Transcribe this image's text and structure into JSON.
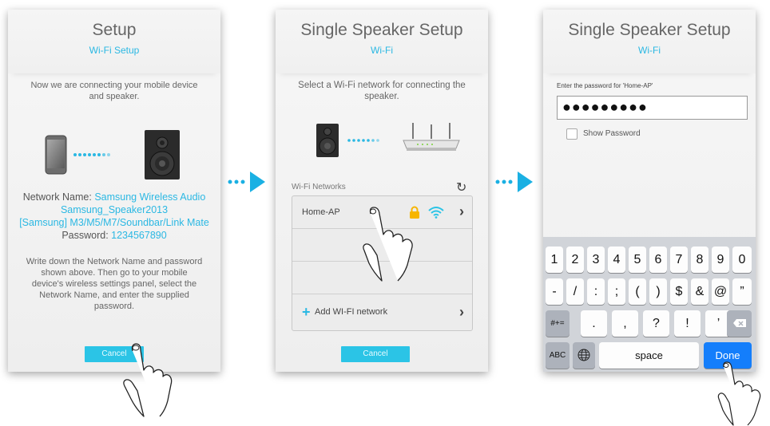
{
  "screen1": {
    "title": "Setup",
    "subtitle": "Wi-Fi Setup",
    "intro": "Now we are connecting your mobile device and speaker.",
    "network_name_label": "Network Name:",
    "network_name_value_1": "Samsung Wireless Audio",
    "network_name_value_2": "Samsung_Speaker2013",
    "network_name_value_3": "[Samsung] M3/M5/M7/Soundbar/Link Mate",
    "password_label": "Password:",
    "password_value": "1234567890",
    "instructions": "Write down the Network Name and password shown above. Then go to your mobile device's wireless settings panel, select the Network Name, and enter the supplied password.",
    "cancel_label": "Cancel"
  },
  "screen2": {
    "title": "Single Speaker Setup",
    "subtitle": "Wi-Fi",
    "intro": "Select a Wi-Fi network for connecting the speaker.",
    "networks_label": "Wi-Fi Networks",
    "networks": [
      {
        "name": "Home-AP"
      },
      {
        "name": ""
      },
      {
        "name": ""
      }
    ],
    "add_network_label": "Add WI-FI network",
    "cancel_label": "Cancel"
  },
  "screen3": {
    "title": "Single Speaker Setup",
    "subtitle": "Wi-Fi",
    "password_prompt": "Enter the password for 'Home-AP'",
    "password_masked": "●●●●●●●●●",
    "show_password_label": "Show Password",
    "keyboard": {
      "row1": [
        "1",
        "2",
        "3",
        "4",
        "5",
        "6",
        "7",
        "8",
        "9",
        "0"
      ],
      "row2": [
        "-",
        "/",
        ":",
        ";",
        "(",
        ")",
        "$",
        "&",
        "@",
        "”"
      ],
      "row3_mode": "#+=",
      "row3": [
        ".",
        ",",
        "?",
        "!",
        "’"
      ],
      "abc_label": "ABC",
      "space_label": "space",
      "done_label": "Done"
    }
  },
  "colors": {
    "accent": "#2bb8e3",
    "button": "#2bc4e6",
    "done_key": "#147efb",
    "lock": "#f7b500"
  }
}
